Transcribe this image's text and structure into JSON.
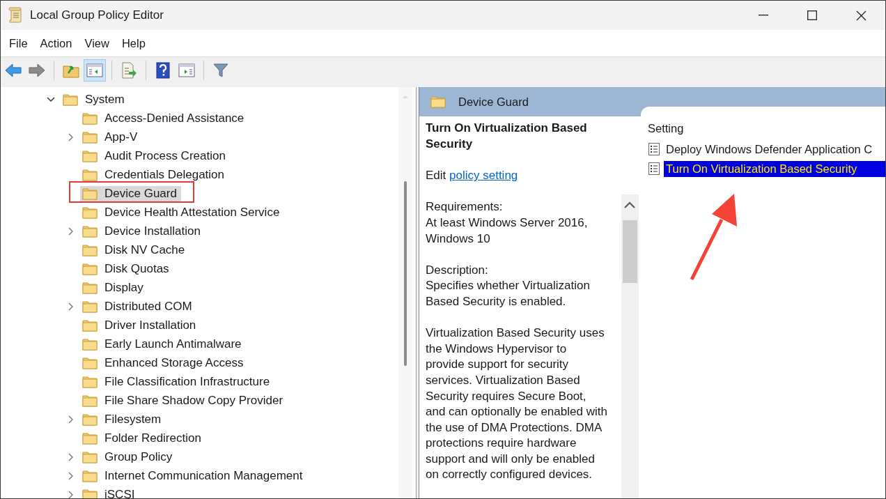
{
  "window": {
    "title": "Local Group Policy Editor"
  },
  "menu": [
    "File",
    "Action",
    "View",
    "Help"
  ],
  "toolbar": [
    [
      {
        "kind": "back",
        "pressed": false
      },
      {
        "kind": "forward",
        "pressed": false
      }
    ],
    [
      {
        "kind": "up",
        "pressed": false
      },
      {
        "kind": "tree",
        "pressed": true
      }
    ],
    [
      {
        "kind": "export",
        "pressed": false
      }
    ],
    [
      {
        "kind": "help",
        "pressed": false
      },
      {
        "kind": "pane",
        "pressed": false
      }
    ],
    [
      {
        "kind": "filter",
        "pressed": false
      }
    ]
  ],
  "tree": {
    "items": [
      {
        "label": "System",
        "expandable": true,
        "expanded": true,
        "selected": false,
        "highlighted": false,
        "children": [
          {
            "label": "Access-Denied Assistance",
            "expandable": false,
            "selected": false,
            "highlighted": false
          },
          {
            "label": "App-V",
            "expandable": true,
            "expanded": false,
            "selected": false,
            "highlighted": false
          },
          {
            "label": "Audit Process Creation",
            "expandable": false,
            "selected": false,
            "highlighted": false
          },
          {
            "label": "Credentials Delegation",
            "expandable": false,
            "selected": false,
            "highlighted": false
          },
          {
            "label": "Device Guard",
            "expandable": false,
            "selected": true,
            "highlighted": true
          },
          {
            "label": "Device Health Attestation Service",
            "expandable": false,
            "selected": false,
            "highlighted": false
          },
          {
            "label": "Device Installation",
            "expandable": true,
            "expanded": false,
            "selected": false,
            "highlighted": false
          },
          {
            "label": "Disk NV Cache",
            "expandable": false,
            "selected": false,
            "highlighted": false
          },
          {
            "label": "Disk Quotas",
            "expandable": false,
            "selected": false,
            "highlighted": false
          },
          {
            "label": "Display",
            "expandable": false,
            "selected": false,
            "highlighted": false
          },
          {
            "label": "Distributed COM",
            "expandable": true,
            "expanded": false,
            "selected": false,
            "highlighted": false
          },
          {
            "label": "Driver Installation",
            "expandable": false,
            "selected": false,
            "highlighted": false
          },
          {
            "label": "Early Launch Antimalware",
            "expandable": false,
            "selected": false,
            "highlighted": false
          },
          {
            "label": "Enhanced Storage Access",
            "expandable": false,
            "selected": false,
            "highlighted": false
          },
          {
            "label": "File Classification Infrastructure",
            "expandable": false,
            "selected": false,
            "highlighted": false
          },
          {
            "label": "File Share Shadow Copy Provider",
            "expandable": false,
            "selected": false,
            "highlighted": false
          },
          {
            "label": "Filesystem",
            "expandable": true,
            "expanded": false,
            "selected": false,
            "highlighted": false
          },
          {
            "label": "Folder Redirection",
            "expandable": false,
            "selected": false,
            "highlighted": false
          },
          {
            "label": "Group Policy",
            "expandable": true,
            "expanded": false,
            "selected": false,
            "highlighted": false
          },
          {
            "label": "Internet Communication Management",
            "expandable": true,
            "expanded": false,
            "selected": false,
            "highlighted": false
          },
          {
            "label": "iSCSI",
            "expandable": true,
            "expanded": false,
            "selected": false,
            "highlighted": false
          }
        ]
      }
    ]
  },
  "details": {
    "header": "Device Guard",
    "title": "Turn On Virtualization Based Security",
    "edit_prefix": "Edit",
    "edit_link": "policy setting",
    "requirements_label": "Requirements:",
    "requirements": "At least Windows Server 2016, Windows 10",
    "description_label": "Description:",
    "description": [
      "Specifies whether Virtualization Based Security is enabled.",
      "Virtualization Based Security uses the Windows Hypervisor to provide support for security services. Virtualization Based Security requires Secure Boot, and can optionally be enabled with the use of DMA Protections. DMA protections require hardware support and will only be enabled on correctly configured devices."
    ]
  },
  "settings": {
    "column": "Setting",
    "rows": [
      {
        "label": "Deploy Windows Defender Application C",
        "selected": false
      },
      {
        "label": "Turn On Virtualization Based Security",
        "selected": true
      }
    ]
  }
}
